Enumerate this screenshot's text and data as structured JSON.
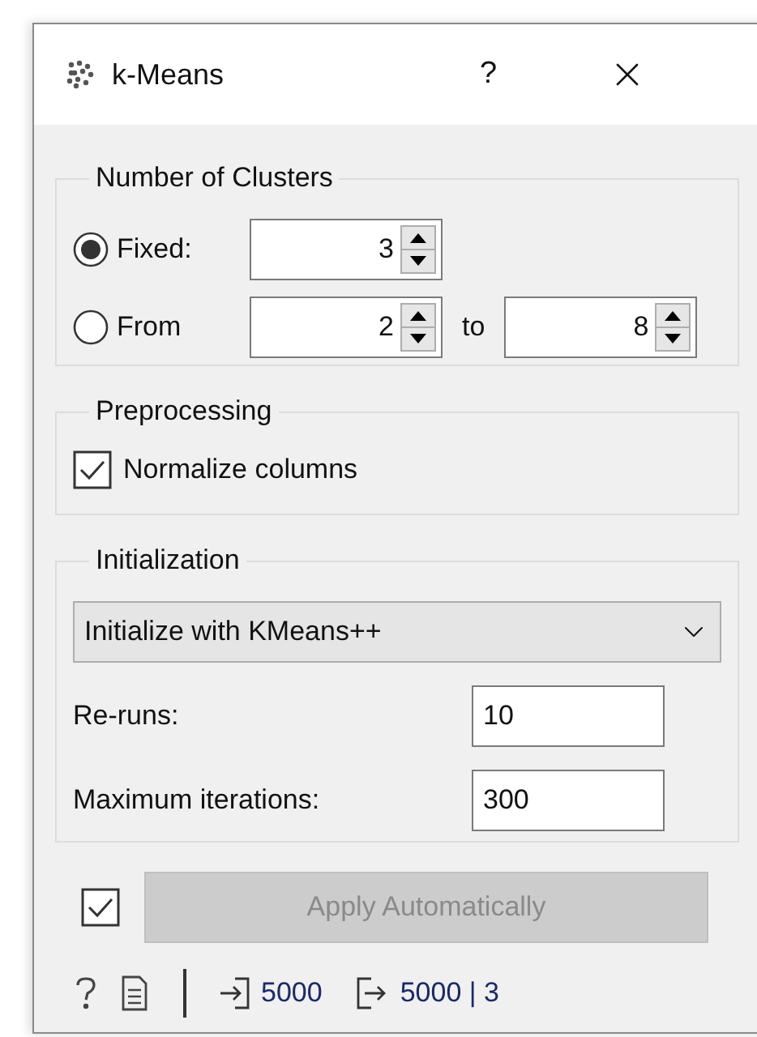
{
  "window": {
    "title": "k-Means",
    "help": "?"
  },
  "clusters": {
    "title": "Number of Clusters",
    "options": [
      {
        "label": "Fixed:",
        "selected": true,
        "spins": [
          "3"
        ]
      },
      {
        "label": "From",
        "selected": false,
        "spins": [
          "2",
          "8"
        ],
        "between": "to"
      }
    ]
  },
  "preprocessing": {
    "title": "Preprocessing",
    "checkbox": {
      "label": "Normalize columns",
      "checked": true
    }
  },
  "initialization": {
    "title": "Initialization",
    "dropdown": "Initialize with KMeans++",
    "fields": [
      {
        "label": "Re-runs:",
        "value": "10"
      },
      {
        "label": "Maximum iterations:",
        "value": "300"
      }
    ]
  },
  "apply": {
    "checked": true,
    "label": "Apply Automatically",
    "disabled": true
  },
  "status_bar": {
    "input_count": "5000",
    "output_count": "5000 | 3"
  }
}
